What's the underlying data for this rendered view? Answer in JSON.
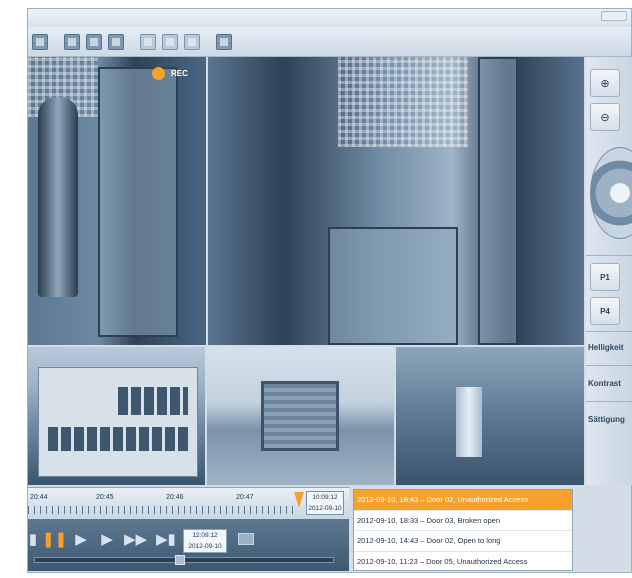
{
  "toolbar": {
    "buttons": [
      "stop-icon",
      "snapshot-icon",
      "search-icon",
      "export-icon",
      "layout-single-icon",
      "layout-quad-icon",
      "layout-multi-icon",
      "fullscreen-icon"
    ]
  },
  "video": {
    "rec_label": "REC"
  },
  "sidebar": {
    "zoom_in": "⊕",
    "zoom_out": "⊖",
    "preset_1": "P1",
    "preset_4": "P4",
    "brightness_label": "Helligkeit",
    "contrast_label": "Kontrast",
    "saturation_label": "Sättigung"
  },
  "timeline": {
    "ticks": [
      "20:44",
      "20:45",
      "20:46",
      "20:47"
    ],
    "current_time": "10:09:12",
    "current_date": "2012-09-10"
  },
  "controls": {
    "clock_time": "12:09:12",
    "clock_date": "2012-09-10"
  },
  "events": [
    {
      "text": "2012-09-10, 18:43 – Door 02, Unauthorized Access",
      "active": true
    },
    {
      "text": "2012-09-10, 18:33 – Door 03, Broken open",
      "active": false
    },
    {
      "text": "2012-09-10, 14:43 – Door 02, Open to long",
      "active": false
    },
    {
      "text": "2012-09-10, 11:23 – Door 05, Unauthorized Access",
      "active": false
    }
  ],
  "colors": {
    "accent": "#f6a12b",
    "video_tint": "#6f8aa3",
    "panel": "#d2dde8"
  }
}
